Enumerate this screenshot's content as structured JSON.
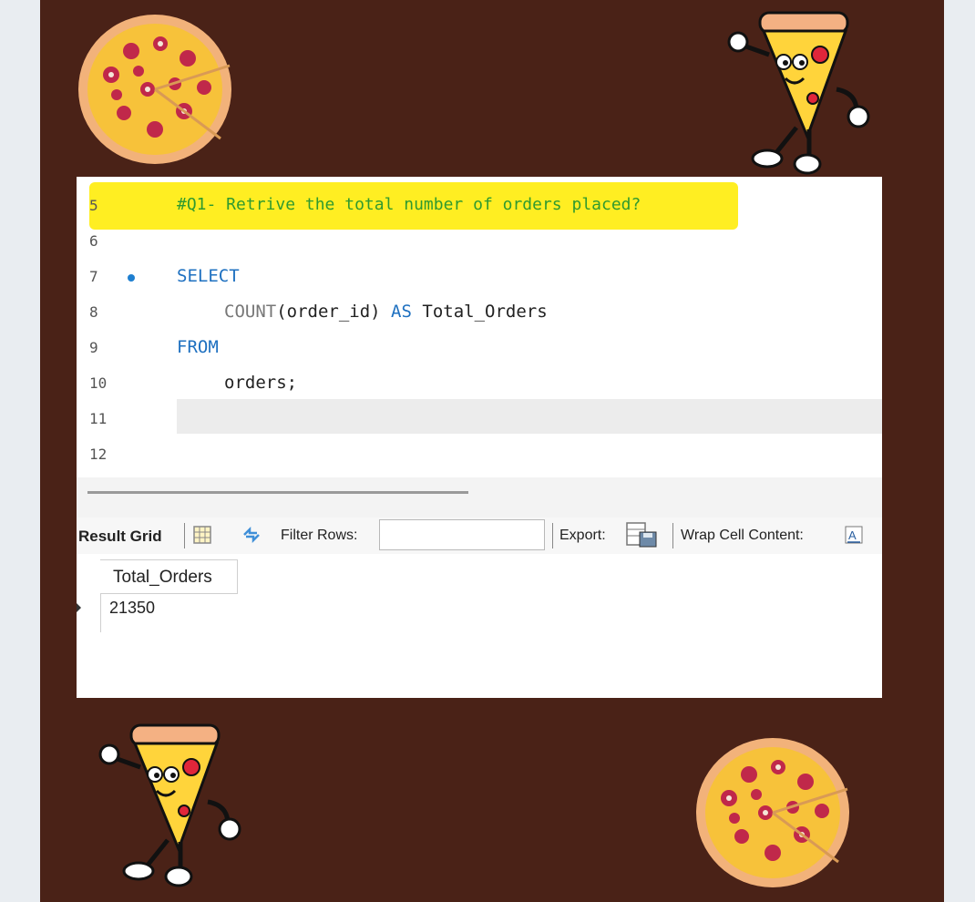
{
  "editor": {
    "lines": [
      {
        "number": "5",
        "code": "#Q1- Retrive the total number of orders placed?"
      },
      {
        "number": "6",
        "code": ""
      },
      {
        "number": "7",
        "code": "SELECT"
      },
      {
        "number": "8",
        "fn": "COUNT",
        "code": "(order_id)",
        "kw": "AS",
        "alias": "Total_Orders"
      },
      {
        "number": "9",
        "code": "FROM"
      },
      {
        "number": "10",
        "code": "orders;"
      },
      {
        "number": "11",
        "code": ""
      },
      {
        "number": "12",
        "code": ""
      }
    ]
  },
  "toolbar": {
    "result_grid_label": "Result Grid",
    "filter_label": "Filter Rows:",
    "filter_value": "",
    "export_label": "Export:",
    "wrap_label": "Wrap Cell Content:"
  },
  "result": {
    "columns": [
      "Total_Orders"
    ],
    "rows": [
      [
        "21350"
      ]
    ]
  },
  "colors": {
    "background": "#4a2217",
    "highlight": "#ffee22",
    "keyword": "#1e70c0",
    "comment": "#2f9a2f"
  },
  "icons": [
    "pizza-icon",
    "pizza-slice-mascot-icon",
    "grid-icon",
    "refresh-icon",
    "export-icon",
    "wrap-icon"
  ]
}
